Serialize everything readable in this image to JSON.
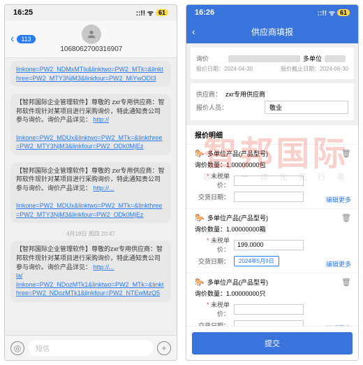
{
  "watermark": {
    "main": "智邦国际",
    "sub": "数 智 一 体 化 先 行 者"
  },
  "left": {
    "time": "16:25",
    "signal": "::!! ᯤ",
    "battery": "61",
    "back_badge": "113",
    "phone_number": "1068062700316907",
    "messages": [
      {
        "prefix_link": "linkone=PW2_NDMxMTlx&linktwo=PW2_MTk=&linkthree=PW2_MTY3NjM3&linkfour=PW2_MiYwODI3",
        "body": "【智邦国际企业管理软件】尊敬的 zxr专用供应商：智邦软件现针对某项目进行采购询价，特此通知贵公司参与询价。询价产品详见：",
        "link": "http://",
        "suffix_link": "linkone=PW2_MDUx&linktwo=PW2_MTk=&linkthree=PW2_MTY3NjM3&linkfour=PW2_ODk0MjEz"
      },
      {
        "body": "【智邦国际企业管理软件】尊敬的 zxr专用供应商：智邦软件现针对某项目进行采购询价，特此通知贵公司参与询价。询价产品详见：",
        "link": "http://...",
        "suffix_link": "linkone=PW2_MDUx&linktwo=PW2_MTk=&linkthree=PW2_MTY3NjM3&linkfour=PW2_ODk0MjEz"
      },
      {
        "date": "4月18日 周四 20:47",
        "body": "【智邦国际企业管理软件】尊敬的zxr专用供应商：智邦软件现针对某项目进行采购询价，特此通知贵公司参与询价。询价产品详见：",
        "link": "http://...",
        "tail": "la/",
        "suffix_link": "linkone=PW2_NDozMTk1&linktwo=PW2_MTk=&linkthree=PW2_NDozMTk1&linkfour=PW2_NTEwMzQ5"
      }
    ],
    "input_placeholder": "短信"
  },
  "right": {
    "time": "16:26",
    "signal": "::!! ᯤ",
    "battery": "61",
    "title": "供应商填报",
    "inquiry_label": "询价",
    "unit_suffix": "多单位",
    "quote_date_label": "报价日期：",
    "quote_date": "2024-04-30",
    "deadline_label": "报价截止日期：",
    "deadline": "2024-06-30",
    "supplier_label": "供应商：",
    "supplier": "zxr专用供应商",
    "reporter_label": "报价人员：",
    "reporter": "敬业",
    "detail_title": "报价明细",
    "items": [
      {
        "name": "多单位产品(产品型号)",
        "qty_label": "询价数量：",
        "qty": "1.00000000包",
        "price_label": "未税单价：",
        "date_label": "交货日期：",
        "more": "编辑更多"
      },
      {
        "name": "多单位产品(产品型号)",
        "qty_label": "询价数量：",
        "qty": "1.00000000箱",
        "price_label": "未税单价：",
        "price": "199.0000",
        "date_label": "交货日期：",
        "date": "2024年5月9日",
        "more": "编辑更多"
      },
      {
        "name": "多单位产品(产品型号)",
        "qty_label": "询价数量：",
        "qty": "1.00000000只",
        "price_label": "未税单价：",
        "date_label": "交货日期：",
        "more": "编辑更多"
      }
    ],
    "submit": "提交"
  }
}
